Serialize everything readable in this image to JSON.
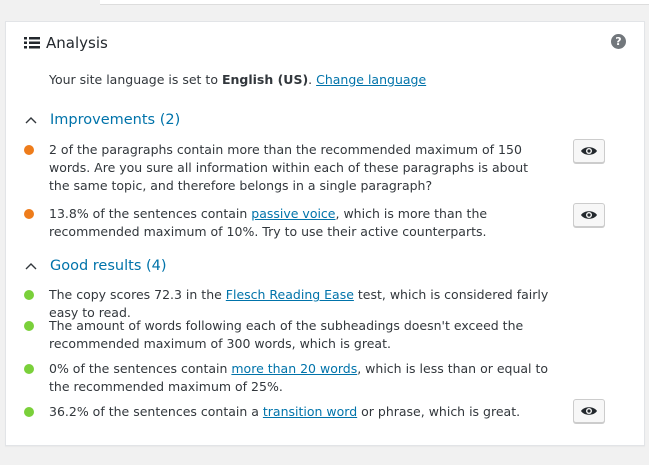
{
  "header": {
    "title": "Analysis",
    "icon": "list-icon",
    "help_icon": "help-icon",
    "help_symbol": "?"
  },
  "language": {
    "prefix": "Your site language is set to ",
    "language": "English (US)",
    "after": ". ",
    "change_link": "Change language"
  },
  "colors": {
    "orange": "#ee7c1b",
    "green": "#7ad03a",
    "link": "#0073aa"
  },
  "improvements": {
    "title": "Improvements (2)",
    "items": [
      {
        "text_before": "2 of the paragraphs contain more than the recommended maximum of 150 words. Are you sure all information within each of these paragraphs is about the same topic, and therefore belongs in a single paragraph?",
        "link": "",
        "text_after": "",
        "status": "orange",
        "has_eye": true
      },
      {
        "text_before": "13.8% of the sentences contain ",
        "link": "passive voice",
        "text_after": ", which is more than the recommended maximum of 10%. Try to use their active counterparts.",
        "status": "orange",
        "has_eye": true
      }
    ]
  },
  "good": {
    "title": "Good results (4)",
    "items": [
      {
        "text_before": "The copy scores 72.3 in the ",
        "link": "Flesch Reading Ease",
        "text_after": " test, which is considered fairly easy to read.",
        "status": "green",
        "has_eye": false
      },
      {
        "text_before": "The amount of words following each of the subheadings doesn't exceed the recommended maximum of 300 words, which is great.",
        "link": "",
        "text_after": "",
        "status": "green",
        "has_eye": false
      },
      {
        "text_before": "0% of the sentences contain ",
        "link": "more than 20 words",
        "text_after": ", which is less than or equal to the recommended maximum of 25%.",
        "status": "green",
        "has_eye": false
      },
      {
        "text_before": "36.2% of the sentences contain a ",
        "link": "transition word",
        "text_after": " or phrase, which is great.",
        "status": "green",
        "has_eye": true
      }
    ]
  }
}
